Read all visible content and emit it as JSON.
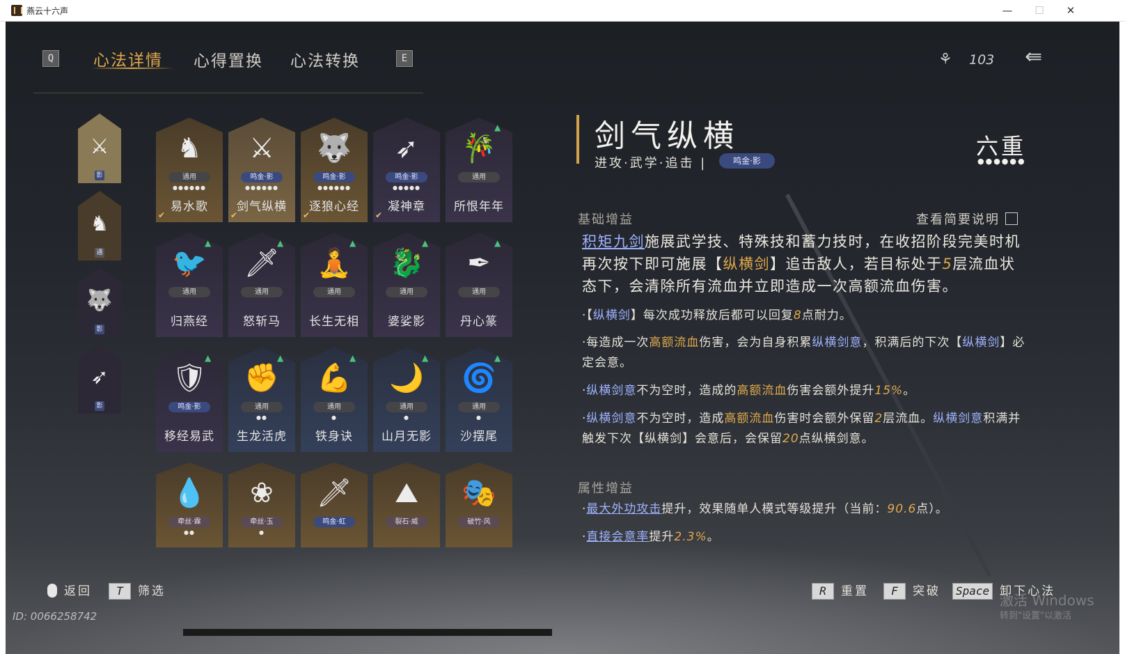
{
  "window": {
    "title": "燕云十六声",
    "minimize": "—",
    "maximize": "☐",
    "close": "✕"
  },
  "nav": {
    "key_left": "Q",
    "key_right": "E",
    "tabs": [
      "心法详情",
      "心得置换",
      "心法转换"
    ],
    "currency_value": "103"
  },
  "sidebar": [
    {
      "tag": "影",
      "glyph": "⚔"
    },
    {
      "tag": "通",
      "glyph": "♞"
    },
    {
      "tag": "影",
      "glyph": "🐺"
    },
    {
      "tag": "影",
      "glyph": "➶"
    }
  ],
  "grid": [
    {
      "name": "易水歌",
      "badge": "通用",
      "dots": "●●●●●●",
      "glyph": "♞"
    },
    {
      "name": "剑气纵横",
      "badge": "鸣金·影",
      "dots": "●●●●●●",
      "glyph": "⚔"
    },
    {
      "name": "逐狼心经",
      "badge": "鸣金·影",
      "dots": "●●●●●●",
      "glyph": "🐺"
    },
    {
      "name": "凝神章",
      "badge": "鸣金·影",
      "dots": "●●●●●",
      "glyph": "➶"
    },
    {
      "name": "所恨年年",
      "badge": "通用",
      "dots": "",
      "glyph": "🎋"
    },
    {
      "name": "归燕经",
      "badge": "通用",
      "dots": "",
      "glyph": "🐦"
    },
    {
      "name": "怒斩马",
      "badge": "通用",
      "dots": "",
      "glyph": "🗡"
    },
    {
      "name": "长生无相",
      "badge": "通用",
      "dots": "",
      "glyph": "🧘"
    },
    {
      "name": "婆娑影",
      "badge": "通用",
      "dots": "",
      "glyph": "🐉"
    },
    {
      "name": "丹心篆",
      "badge": "通用",
      "dots": "",
      "glyph": "✒"
    },
    {
      "name": "移经易武",
      "badge": "鸣金·影",
      "dots": "",
      "glyph": "🛡"
    },
    {
      "name": "生龙活虎",
      "badge": "通用",
      "dots": "●●",
      "glyph": "✊"
    },
    {
      "name": "铁身诀",
      "badge": "通用",
      "dots": "●",
      "glyph": "💪"
    },
    {
      "name": "山月无影",
      "badge": "通用",
      "dots": "●",
      "glyph": "🌙"
    },
    {
      "name": "沙摆尾",
      "badge": "通用",
      "dots": "●",
      "glyph": "🌀"
    },
    {
      "name": "",
      "badge": "牵丝·霖",
      "dots": "●●",
      "glyph": "💧"
    },
    {
      "name": "",
      "badge": "牵丝·玉",
      "dots": "●",
      "glyph": "❀"
    },
    {
      "name": "",
      "badge": "鸣金·虹",
      "dots": "",
      "glyph": "🗡"
    },
    {
      "name": "",
      "badge": "裂石·威",
      "dots": "",
      "glyph": "⛰"
    },
    {
      "name": "",
      "badge": "破竹·风",
      "dots": "",
      "glyph": "🎭"
    }
  ],
  "detail": {
    "title": "剑气纵横",
    "subtitle": "进攻·武学·追击 |",
    "tag": "鸣金·影",
    "rank": "六重",
    "rank_dots": "●●●●●●",
    "section_basic": "基础增益",
    "view_brief": "查看简要说明",
    "desc_link": "积矩九剑",
    "desc_1": "施展武学技、特殊技和蓄力技时，在收招阶段完美时机再次按下即可施展【",
    "desc_gold": "纵横剑",
    "desc_2": "】追击敌人，若目标处于",
    "desc_num": "5",
    "desc_3": "层流血状态下，会清除所有流血并立即造成一次高额流血伤害。",
    "b1_a": "·【",
    "b1_blue": "纵横剑",
    "b1_b": "】每次成功释放后都可以回复",
    "b1_num": "8",
    "b1_c": "点耐力。",
    "b2_a": "·每造成一次",
    "b2_gold": "高额流血",
    "b2_b": "伤害，会为自身积累",
    "b2_blue": "纵横剑意",
    "b2_c": "，积满后的下次【",
    "b2_blue2": "纵横剑",
    "b2_d": "】必定会意。",
    "b3_a": "·",
    "b3_blue": "纵横剑意",
    "b3_b": "不为空时，造成的",
    "b3_gold": "高额流血",
    "b3_c": "伤害会额外提升",
    "b3_num": "15%",
    "b3_d": "。",
    "b4_a": "·",
    "b4_blue": "纵横剑意",
    "b4_b": "不为空时，造成",
    "b4_gold": "高额流血",
    "b4_c": "伤害时会额外保留",
    "b4_num": "2",
    "b4_d": "层流血。",
    "b4_blue2": "纵横剑意",
    "b4_e": "积满并触发下次【纵横剑】会意后，会保留",
    "b4_num2": "20",
    "b4_f": "点纵横剑意。",
    "section_attr": "属性增益",
    "a1_link": "最大外功攻击",
    "a1_b": "提升，效果随单人模式等级提升（当前：",
    "a1_num": "90.6",
    "a1_c": "点）。",
    "a2_link": "直接会意率",
    "a2_b": "提升",
    "a2_num": "2.3%",
    "a2_c": "。"
  },
  "bottom": {
    "back_label": "返回",
    "filter_key": "T",
    "filter_label": "筛选",
    "reset_key": "R",
    "reset_label": "重置",
    "break_key": "F",
    "break_label": "突破",
    "unload_key": "Space",
    "unload_label": "卸下心法",
    "id_text": "ID: 0066258742",
    "watermark": "激活 Windows",
    "watermark2": "转到\"设置\"以激活"
  },
  "colors": {
    "accent": "#e0a84c",
    "link": "#9fb2ff",
    "badge_mingjin": "#3b4a7e"
  }
}
